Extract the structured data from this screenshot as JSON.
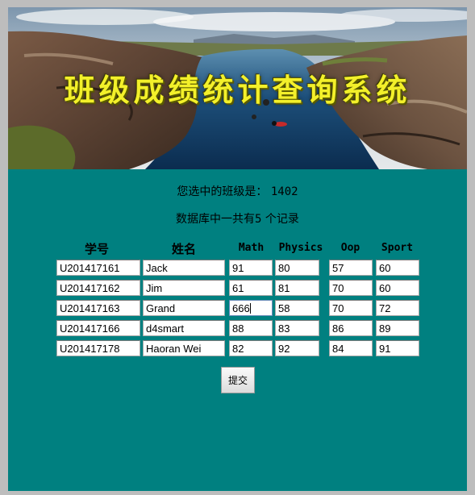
{
  "banner": {
    "title": "班级成绩统计查询系统"
  },
  "class_line": {
    "label": "您选中的班级是：",
    "value": "1402"
  },
  "count_line": {
    "prefix": "数据库中一共有",
    "count": "5",
    "suffix": " 个记录"
  },
  "table": {
    "headers": [
      "学号",
      "姓名",
      "Math",
      "Physics",
      "Oop",
      "Sport"
    ],
    "rows": [
      [
        "U201417161",
        "Jack",
        "91",
        "80",
        "57",
        "60"
      ],
      [
        "U201417162",
        "Jim",
        "61",
        "81",
        "70",
        "60"
      ],
      [
        "U201417163",
        "Grand",
        "666",
        "58",
        "70",
        "72"
      ],
      [
        "U201417166",
        "d4smart",
        "88",
        "83",
        "86",
        "89"
      ],
      [
        "U201417178",
        "Haoran Wei",
        "82",
        "92",
        "84",
        "91"
      ]
    ],
    "focused_cell": "2.2"
  },
  "submit_label": "提交",
  "colors": {
    "background": "#008080",
    "frame": "#bdbdbd",
    "title": "#f3f02a"
  }
}
